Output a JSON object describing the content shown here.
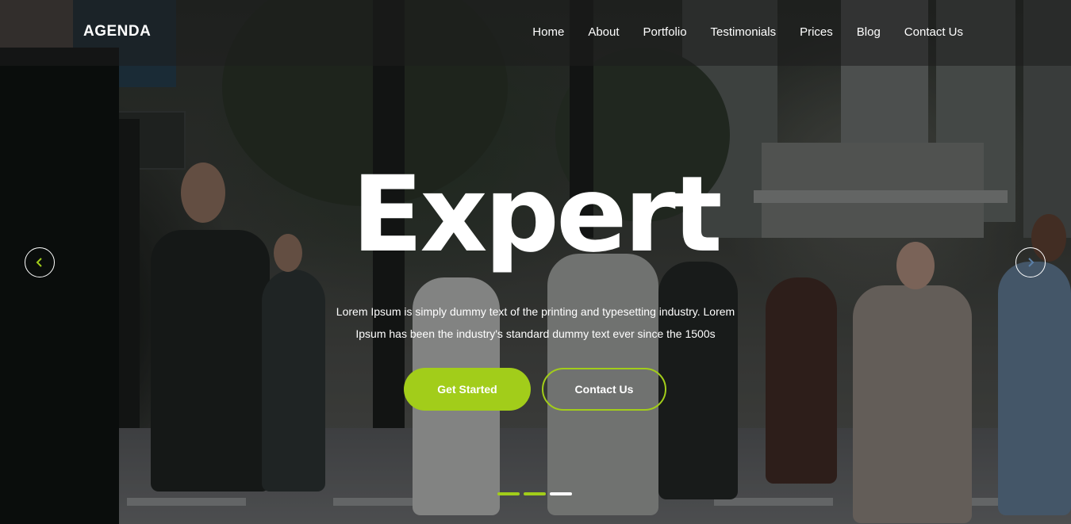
{
  "brand": "AGENDA",
  "nav": {
    "items": [
      "Home",
      "About",
      "Portfolio",
      "Testimonials",
      "Prices",
      "Blog",
      "Contact Us"
    ]
  },
  "hero": {
    "headline": "Expert",
    "tagline": "Lorem Ipsum is simply dummy text of the printing and typesetting industry. Lorem Ipsum has been the industry's standard dummy text ever since the 1500s",
    "primary_button": "Get Started",
    "secondary_button": "Contact Us"
  },
  "carousel": {
    "prev_icon": "chevron-left-icon",
    "next_icon": "chevron-right-icon",
    "slide_count": 3,
    "active_slide": 3
  },
  "colors": {
    "accent": "#a2cd1a",
    "text": "#ffffff"
  }
}
